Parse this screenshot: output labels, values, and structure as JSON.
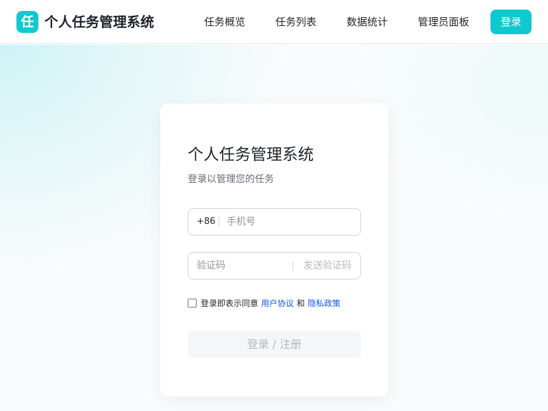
{
  "header": {
    "logo_text": "任",
    "app_title": "个人任务管理系统",
    "nav": [
      "任务概览",
      "任务列表",
      "数据统计",
      "管理员面板"
    ],
    "login_label": "登录"
  },
  "login_card": {
    "title": "个人任务管理系统",
    "subtitle": "登录以管理您的任务",
    "phone": {
      "prefix": "+86",
      "value": "",
      "placeholder": "手机号"
    },
    "code": {
      "value": "",
      "placeholder": "验证码",
      "send_label": "发送验证码"
    },
    "agreement": {
      "checked": false,
      "text": "登录即表示同意",
      "terms_link": "用户协议",
      "and_text": "和",
      "privacy_link": "隐私政策"
    },
    "submit_label": "登录 / 注册"
  },
  "colors": {
    "accent": "#12c8cf",
    "link": "#1456f0",
    "disabled_text": "#b4b8bf",
    "disabled_bg": "#f5f6f7"
  }
}
